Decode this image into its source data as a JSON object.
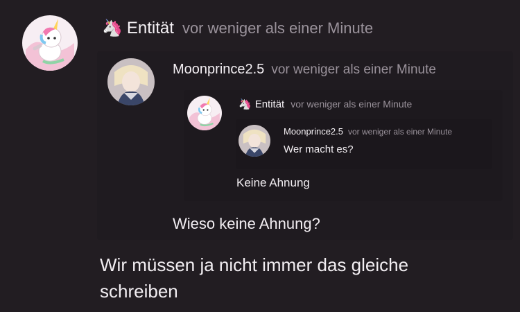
{
  "thread": {
    "post": {
      "author": "Entität",
      "emoji": "🦄",
      "time": "vor weniger als einer Minute",
      "text_line1": "Wir müssen ja nicht immer das gleiche",
      "text_line2": "schreiben"
    },
    "reply1": {
      "author": "Moonprince2.5",
      "time": "vor weniger als einer Minute",
      "text": "Wieso keine Ahnung?"
    },
    "reply2": {
      "author": "Entität",
      "emoji": "🦄",
      "time": "vor weniger als einer Minute",
      "text": "Keine Ahnung"
    },
    "reply3": {
      "author": "Moonprince2.5",
      "time": "vor weniger als einer Minute",
      "text": "Wer macht es?"
    }
  },
  "colors": {
    "background": "#221d22",
    "quote_background": "#1e1a1f",
    "text": "#f2eef2",
    "muted": "#9a929b"
  }
}
